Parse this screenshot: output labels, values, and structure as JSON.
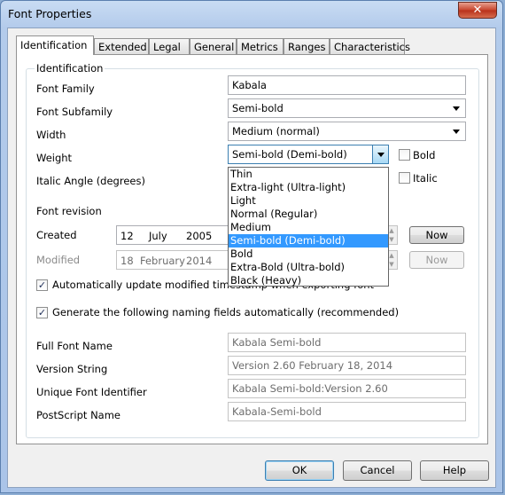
{
  "window": {
    "title": "Font Properties",
    "close_label": "✕"
  },
  "tabs": [
    "Identification",
    "Extended",
    "Legal",
    "General",
    "Metrics",
    "Ranges",
    "Characteristics"
  ],
  "group_title": "Identification",
  "labels": {
    "font_family": "Font Family",
    "font_subfamily": "Font Subfamily",
    "width": "Width",
    "weight": "Weight",
    "italic_angle": "Italic Angle (degrees)",
    "font_revision": "Font revision",
    "created": "Created",
    "modified": "Modified",
    "auto_update": "Automatically update modified timestamp when exporting font",
    "generate_naming": "Generate the following naming fields automatically (recommended)",
    "full_font_name": "Full Font Name",
    "version_string": "Version String",
    "unique_font_identifier": "Unique Font Identifier",
    "postscript_name": "PostScript Name",
    "bold": "Bold",
    "italic": "Italic"
  },
  "values": {
    "font_family": "Kabala",
    "font_subfamily": "Semi-bold",
    "width": "Medium (normal)",
    "weight": "Semi-bold (Demi-bold)",
    "created": {
      "day": "12",
      "month": "July",
      "year": "2005"
    },
    "modified": {
      "day": "18",
      "month": "February",
      "year": "2014"
    },
    "full_font_name": "Kabala Semi-bold",
    "version_string": "Version 2.60 February 18, 2014",
    "unique_font_identifier": "Kabala Semi-bold:Version 2.60",
    "postscript_name": "Kabala-Semi-bold",
    "auto_update_checked": true,
    "generate_naming_checked": true,
    "bold_checked": false,
    "italic_checked": false
  },
  "weight_options": [
    "Thin",
    "Extra-light (Ultra-light)",
    "Light",
    "Normal (Regular)",
    "Medium",
    "Semi-bold (Demi-bold)",
    "Bold",
    "Extra-Bold (Ultra-bold)",
    "Black (Heavy)"
  ],
  "weight_selected_index": 5,
  "buttons": {
    "now": "Now",
    "now_disabled": "Now",
    "ok": "OK",
    "cancel": "Cancel",
    "help": "Help"
  }
}
